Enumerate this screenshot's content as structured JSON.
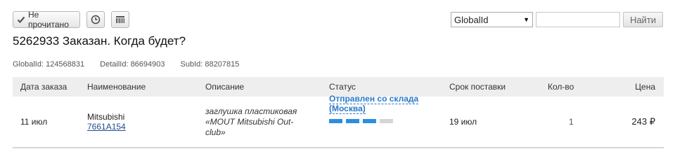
{
  "toolbar": {
    "unread_label": "Не прочитано"
  },
  "search": {
    "select_value": "GlobalId",
    "input_value": "",
    "find_label": "Найти"
  },
  "order": {
    "title": "5262933 Заказан. Когда будет?",
    "global_id": "GlobalId: 124568831",
    "detail_id": "DetailId: 86694903",
    "sub_id": "SubId: 88207815"
  },
  "table": {
    "headers": [
      "Дата заказа",
      "Наименование",
      "Описание",
      "Статус",
      "Срок поставки",
      "Кол-во",
      "Цена"
    ],
    "rows": [
      {
        "date": "11 июл",
        "brand": "Mitsubishi",
        "part_number": "7661A154",
        "description": "заглушка пластиковая «MOUT Mitsubishi Out-club»",
        "status": "Отправлен со склада (Москва)",
        "status_progress": 0.75,
        "term": "19 июл",
        "qty": "1",
        "price": "243 ₽"
      }
    ]
  },
  "colors": {
    "status_blue": "#2a78c8",
    "progress_on": "#2b8fe0",
    "progress_off": "#d5d5d5",
    "header_bg": "#eeeeee"
  }
}
